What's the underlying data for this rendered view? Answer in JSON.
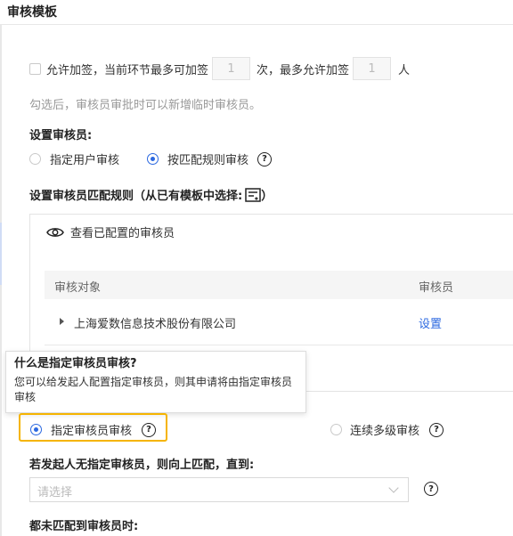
{
  "header": {
    "title": "审核模板"
  },
  "add_sign": {
    "checkbox_label": "允许加签，当前环节最多可加签",
    "times_value": "1",
    "times_unit": "次，最多允许加签",
    "people_value": "1",
    "people_unit": "人",
    "hint": "勾选后，审核员审批时可以新增临时审核员。"
  },
  "reviewer": {
    "label": "设置审核员:",
    "options": [
      "指定用户审核",
      "按匹配规则审核"
    ],
    "selected": "按匹配规则审核"
  },
  "match_rule": {
    "label": "设置审核员匹配规则（从已有模板中选择:",
    "label_end": "）",
    "view_label": "查看已配置的审核员",
    "table": {
      "columns": [
        "审核对象",
        "审核员"
      ],
      "rows": [
        {
          "object": "上海爱数信息技术股份有限公司",
          "action": "设置"
        }
      ]
    }
  },
  "tooltip": {
    "title": "什么是指定审核员审核?",
    "body": "您可以给发起人配置指定审核员，则其申请将由指定审核员审核"
  },
  "mode": {
    "options": [
      "指定审核员审核",
      "连续多级审核"
    ],
    "selected": "指定审核员审核"
  },
  "no_reviewer": {
    "label": "若发起人无指定审核员，则向上匹配，直到:",
    "placeholder": "请选择"
  },
  "fallback": {
    "label": "都未匹配到审核员时:"
  },
  "icons": {
    "help": "question-circle-icon",
    "eye": "eye-icon",
    "template": "template-select-icon",
    "chevron": "chevron-down-icon",
    "caret": "caret-right-icon"
  },
  "colors": {
    "accent": "#2b68e0",
    "highlight": "#f5b400"
  }
}
